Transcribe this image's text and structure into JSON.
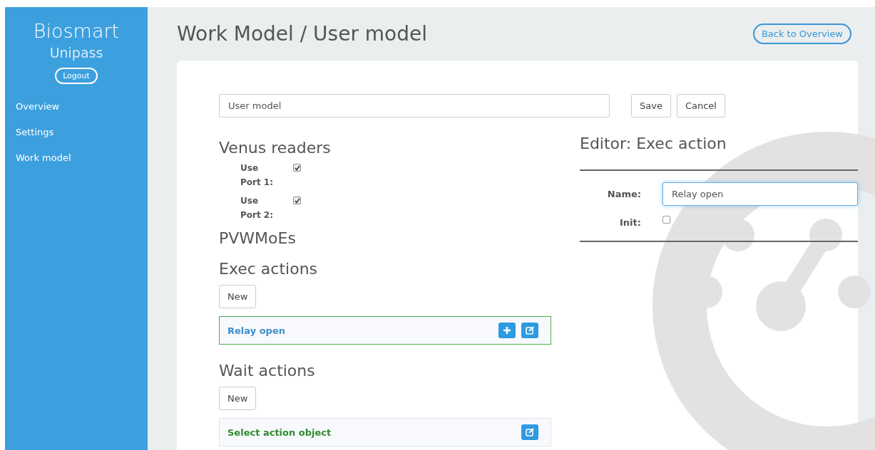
{
  "sidebar": {
    "brand": "Biosmart",
    "product": "Unipass",
    "logout": "Logout",
    "items": [
      {
        "label": "Overview"
      },
      {
        "label": "Settings"
      },
      {
        "label": "Work model"
      }
    ]
  },
  "header": {
    "title": "Work Model / User model",
    "back": "Back to Overview"
  },
  "form": {
    "model_name": "User model",
    "save": "Save",
    "cancel": "Cancel"
  },
  "venus": {
    "title": "Venus readers",
    "ports": [
      {
        "label": "Use Port 1:",
        "checked": true
      },
      {
        "label": "Use Port 2:",
        "checked": true
      }
    ]
  },
  "pvwmoes": {
    "title": "PVWMoEs"
  },
  "exec": {
    "title": "Exec actions",
    "new": "New",
    "items": [
      {
        "label": "Relay open",
        "kind": "action",
        "selected": true
      }
    ]
  },
  "wait": {
    "title": "Wait actions",
    "new": "New",
    "items": [
      {
        "label": "Select action object",
        "kind": "placeholder",
        "selected": false
      }
    ]
  },
  "editor": {
    "title": "Editor: Exec action",
    "name_label": "Name:",
    "name_value": "Relay open",
    "init_label": "Init:",
    "init_checked": false
  }
}
